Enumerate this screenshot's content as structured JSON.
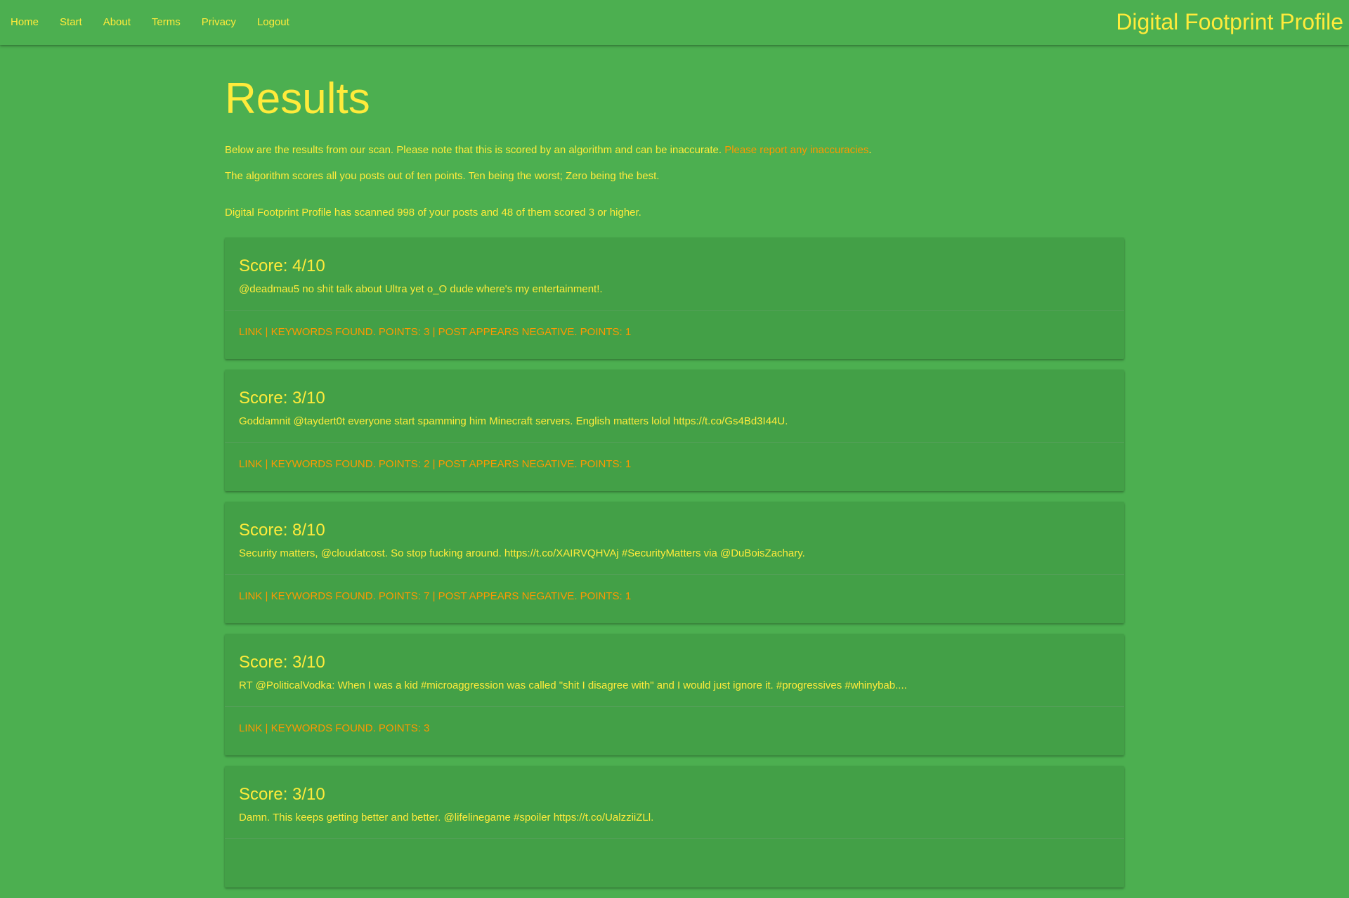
{
  "nav": {
    "links": [
      "Home",
      "Start",
      "About",
      "Terms",
      "Privacy",
      "Logout"
    ],
    "brand": "Digital Footprint Profile"
  },
  "main": {
    "title": "Results",
    "intro_text": "Below are the results from our scan. Please note that this is scored by an algorithm and can be inaccurate. ",
    "report_link": "Please report any inaccuracies",
    "intro_end": ".",
    "scoring_note": "The algorithm scores all you posts out of ten points. Ten being the worst; Zero being the best.",
    "summary": "Digital Footprint Profile has scanned 998 of your posts and 48 of them scored 3 or higher."
  },
  "results": [
    {
      "score": "Score: 4/10",
      "post": "@deadmau5 no shit talk about Ultra yet o_O dude where's my entertainment!.",
      "details": "Link | Keywords found. Points: 3 | Post appears negative. Points: 1"
    },
    {
      "score": "Score: 3/10",
      "post": "Goddamnit @taydert0t everyone start spamming him Minecraft servers. English matters lolol https://t.co/Gs4Bd3I44U.",
      "details": "Link | Keywords found. Points: 2 | Post appears negative. Points: 1"
    },
    {
      "score": "Score: 8/10",
      "post": "Security matters, @cloudatcost. So stop fucking around. https://t.co/XAIRVQHVAj #SecurityMatters via @DuBoisZachary.",
      "details": "Link | Keywords found. Points: 7 | Post appears negative. Points: 1"
    },
    {
      "score": "Score: 3/10",
      "post": "RT @PoliticalVodka: When I was a kid #microaggression was called \"shit I disagree with\" and I would just ignore it. #progressives #whinybab....",
      "details": "Link | Keywords found. Points: 3"
    },
    {
      "score": "Score: 3/10",
      "post": "Damn. This keeps getting better and better. @lifelinegame #spoiler https://t.co/UalzziiZLl.",
      "details": ""
    }
  ],
  "colors": {
    "background": "#4caf50",
    "card": "#43a047",
    "text": "#ffeb3b",
    "accent": "#ff9800"
  }
}
